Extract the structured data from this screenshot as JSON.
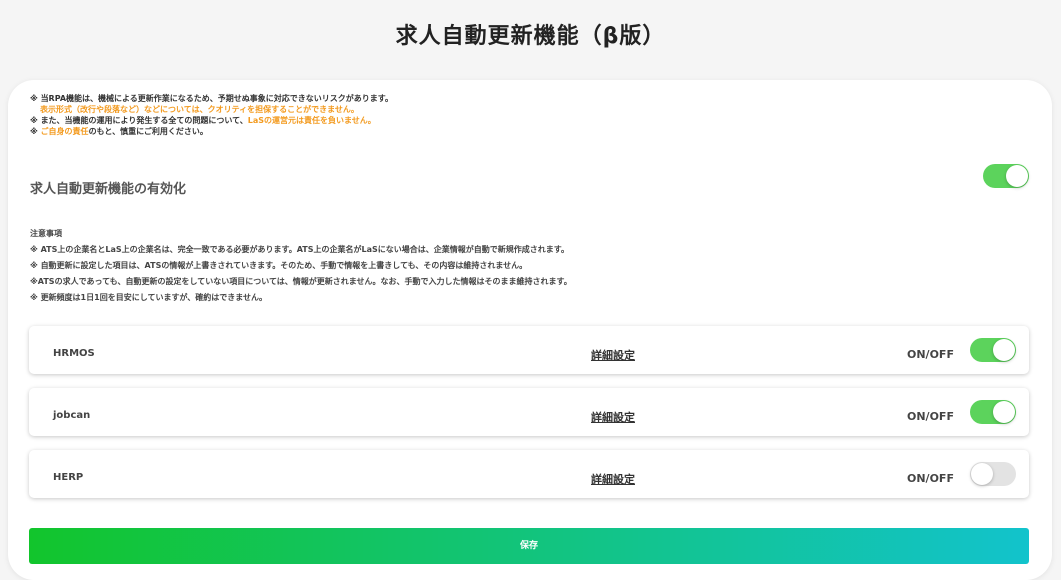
{
  "page_title": "求人自動更新機能（β版）",
  "warning": {
    "line1": "※ 当RPA機能は、機械による更新作業になるため、予期せぬ事象に対応できないリスクがあります。",
    "line2": "表示形式（改行や段落など）などについては、クオリティを担保することができません。",
    "line3_prefix": "※ また、当機能の運用により発生する全ての問題について、",
    "line3_highlight": "LaSの運営元は責任を負いません。",
    "line4_prefix": "※ ",
    "line4_highlight": "ご自身の責任",
    "line4_suffix": "のもと、慎重にご利用ください。"
  },
  "enable": {
    "label": "求人自動更新機能の有効化",
    "on": true
  },
  "notes": {
    "title": "注意事項",
    "items": [
      "※ ATS上の企業名とLaS上の企業名は、完全一致である必要があります。ATS上の企業名がLaSにない場合は、企業情報が自動で新規作成されます。",
      "※ 自動更新に設定した項目は、ATSの情報が上書きされていきます。そのため、手動で情報を上書きしても、その内容は維持されません。",
      "※ATSの求人であっても、自動更新の設定をしていない項目については、情報が更新されません。なお、手動で入力した情報はそのまま維持されます。",
      "※ 更新頻度は1日1回を目安にしていますが、確約はできません。"
    ]
  },
  "ats": [
    {
      "name": "HRMOS",
      "detail": "詳細設定",
      "onoff": "ON/OFF",
      "on": true
    },
    {
      "name": "jobcan",
      "detail": "詳細設定",
      "onoff": "ON/OFF",
      "on": true
    },
    {
      "name": "HERP",
      "detail": "詳細設定",
      "onoff": "ON/OFF",
      "on": false
    }
  ],
  "save_label": "保存",
  "colors": {
    "toggle_on": "#5cd35c",
    "toggle_off": "#e3e3e3",
    "warning_orange": "#f39a1e",
    "save_gradient_start": "#12c52c",
    "save_gradient_end": "#12c3cc"
  }
}
